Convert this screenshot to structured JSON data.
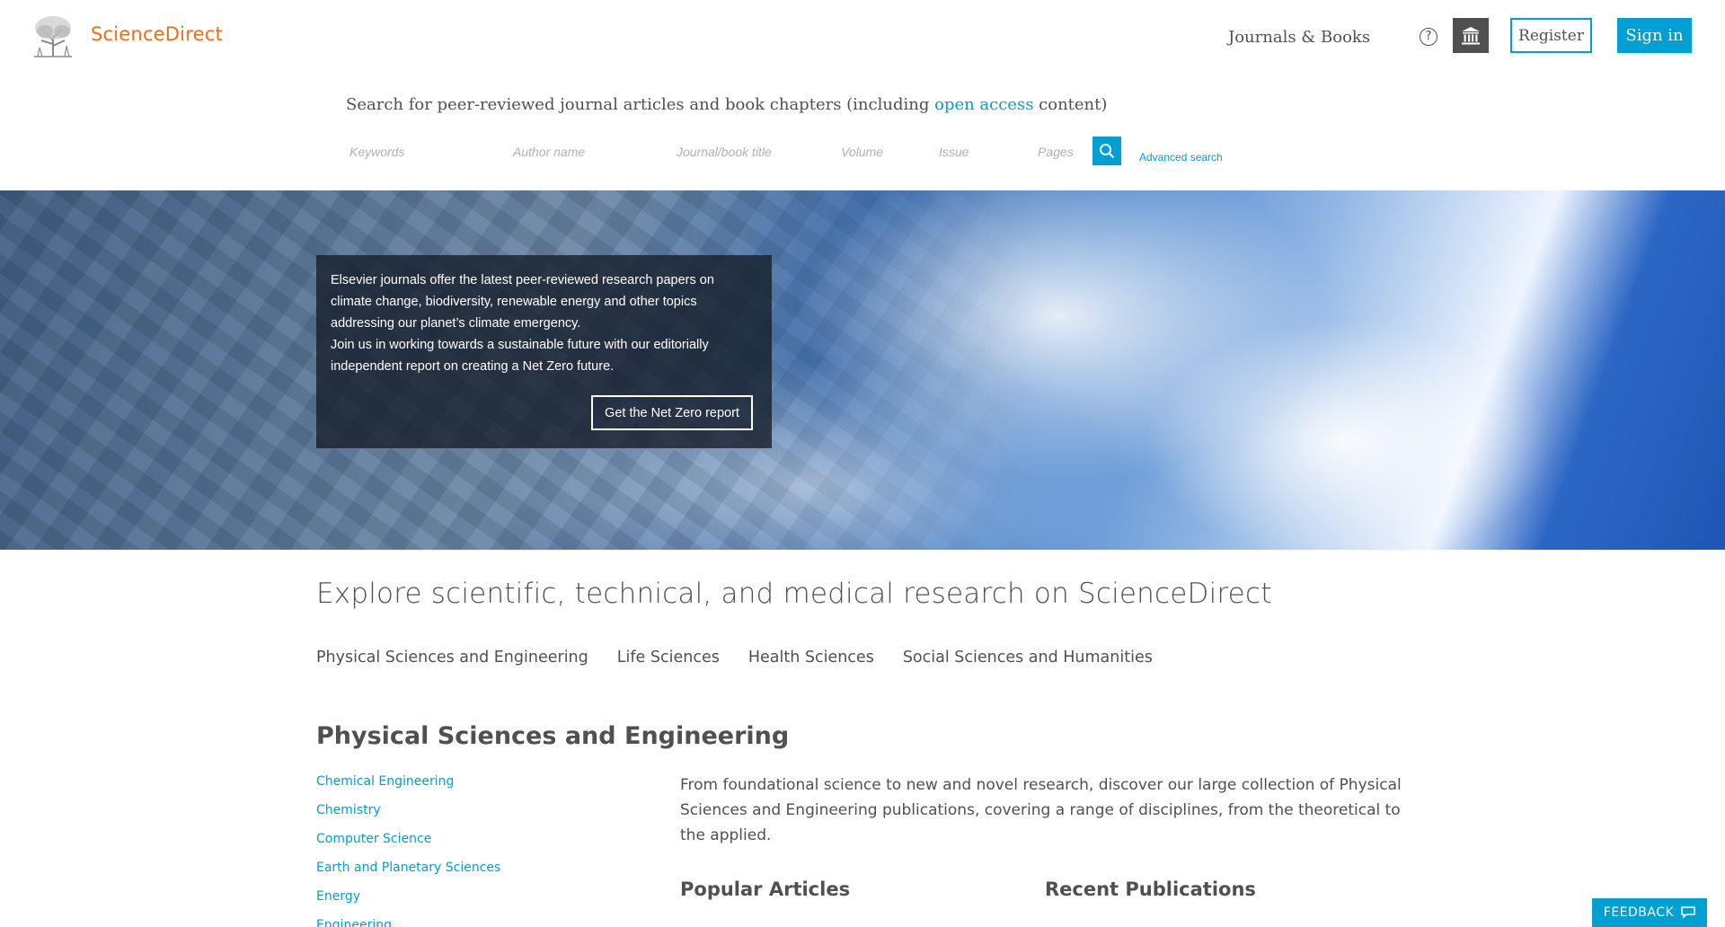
{
  "header": {
    "brand": "ScienceDirect",
    "nav_journals": "Journals & Books",
    "help_glyph": "?",
    "register_label": "Register",
    "signin_label": "Sign in"
  },
  "search": {
    "intro_before": "Search for peer-reviewed journal articles and book chapters (including ",
    "intro_link": "open access",
    "intro_after": " content)",
    "fields": {
      "keywords": "Keywords",
      "author": "Author name",
      "journal": "Journal/book title",
      "volume": "Volume",
      "issue": "Issue",
      "pages": "Pages"
    },
    "advanced_label": "Advanced search"
  },
  "hero": {
    "text_line1": "Elsevier journals offer the latest peer-reviewed research papers on climate change, biodiversity, renewable energy and other topics addressing our planet’s climate emergency.",
    "text_line2": "Join us in working towards a sustainable future with our editorially independent report on creating a Net Zero future.",
    "button_label": "Get the Net Zero report"
  },
  "explore": {
    "title": "Explore scientific, technical, and medical research on ScienceDirect",
    "tabs": [
      "Physical Sciences and Engineering",
      "Life Sciences",
      "Health Sciences",
      "Social Sciences and Humanities"
    ]
  },
  "section": {
    "title": "Physical Sciences and Engineering",
    "disciplines": [
      "Chemical Engineering",
      "Chemistry",
      "Computer Science",
      "Earth and Planetary Sciences",
      "Energy",
      "Engineering"
    ],
    "description": "From foundational science to new and novel research, discover our large collection of Physical Sciences and Engineering publications, covering a range of disciplines, from the theoretical to the applied.",
    "popular_title": "Popular Articles",
    "recent_title": "Recent Publications"
  },
  "feedback_label": "FEEDBACK",
  "colors": {
    "brand_orange": "#e9711c",
    "accent_blue": "#00a0d2",
    "text_gray": "#505050"
  }
}
